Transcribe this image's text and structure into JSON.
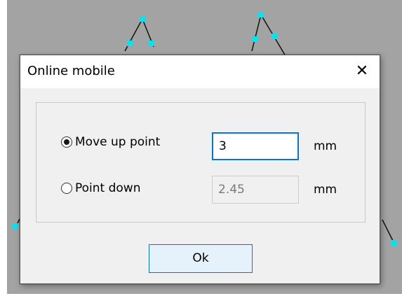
{
  "dialog": {
    "title": "Online mobile",
    "close_glyph": "✕",
    "options": [
      {
        "label": "Move up point",
        "selected": true,
        "value": "3",
        "unit": "mm",
        "enabled": true
      },
      {
        "label": "Point down",
        "selected": false,
        "value": "2.45",
        "unit": "mm",
        "enabled": false
      }
    ],
    "ok_label": "Ok"
  },
  "colors": {
    "canvas_background": "#a3a3a3",
    "control_point": "#00e5ee",
    "accent": "#0078d7"
  }
}
